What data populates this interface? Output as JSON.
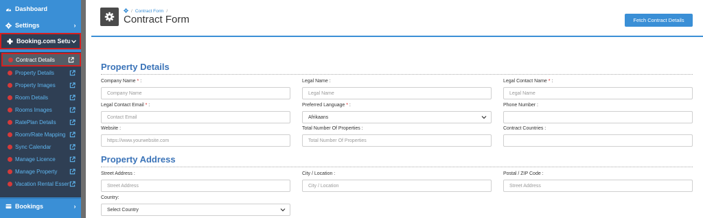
{
  "sidebar": {
    "top_items": [
      {
        "label": "Dashboard",
        "icon": "dashboard-icon"
      },
      {
        "label": "Settings",
        "icon": "gear-icon"
      }
    ],
    "booking_setup": {
      "label": "Booking.com Setup",
      "icon": "plus-cross-icon"
    },
    "sub_items": [
      {
        "label": "Contract Details"
      },
      {
        "label": "Property Details"
      },
      {
        "label": "Property Images"
      },
      {
        "label": "Room Details"
      },
      {
        "label": "Rooms Images"
      },
      {
        "label": "RatePlan Details"
      },
      {
        "label": "Room/Rate Mapping"
      },
      {
        "label": "Sync Calendar"
      },
      {
        "label": "Manage Licence"
      },
      {
        "label": "Manage Property"
      },
      {
        "label": "Vacation Rental Essentials"
      }
    ],
    "bookings": {
      "label": "Bookings",
      "icon": "bookings-icon"
    }
  },
  "header": {
    "breadcrumb": [
      "Contract Form",
      "/"
    ],
    "title": "Contract Form",
    "fetch_button": "Fetch Contract Details"
  },
  "property_details": {
    "title": "Property Details",
    "fields": [
      {
        "label": "Company Name",
        "required": true,
        "placeholder": "Company Name"
      },
      {
        "label": "Legal Name :",
        "required": false,
        "placeholder": "Legal Name"
      },
      {
        "label": "Legal Contact Name",
        "required": true,
        "placeholder": "Legal Name"
      },
      {
        "label": "Legal Contact Email",
        "required": true,
        "placeholder": "Contact Email"
      },
      {
        "label": "Preferred Language",
        "required": true,
        "value": "Afrikaans"
      },
      {
        "label": "Phone Number :",
        "required": false,
        "placeholder": ""
      },
      {
        "label": "Website :",
        "required": false,
        "placeholder": "https://www.yourwebsite.com"
      },
      {
        "label": "Total Number Of Properties :",
        "required": false,
        "placeholder": "Total Number Of Properties"
      },
      {
        "label": "Contract Countries :",
        "required": false,
        "placeholder": ""
      }
    ]
  },
  "property_address": {
    "title": "Property Address",
    "fields": [
      {
        "label": "Street Address :",
        "placeholder": "Street Address"
      },
      {
        "label": "City / Location :",
        "placeholder": "City / Location"
      },
      {
        "label": "Postal / ZIP Code :",
        "placeholder": "Street Address"
      },
      {
        "label": "Country:",
        "value": "Select Country"
      }
    ]
  },
  "colors": {
    "accent": "#3a8fd6",
    "sidebar_dark": "#2f3f54",
    "highlight": "#d61f1f"
  }
}
